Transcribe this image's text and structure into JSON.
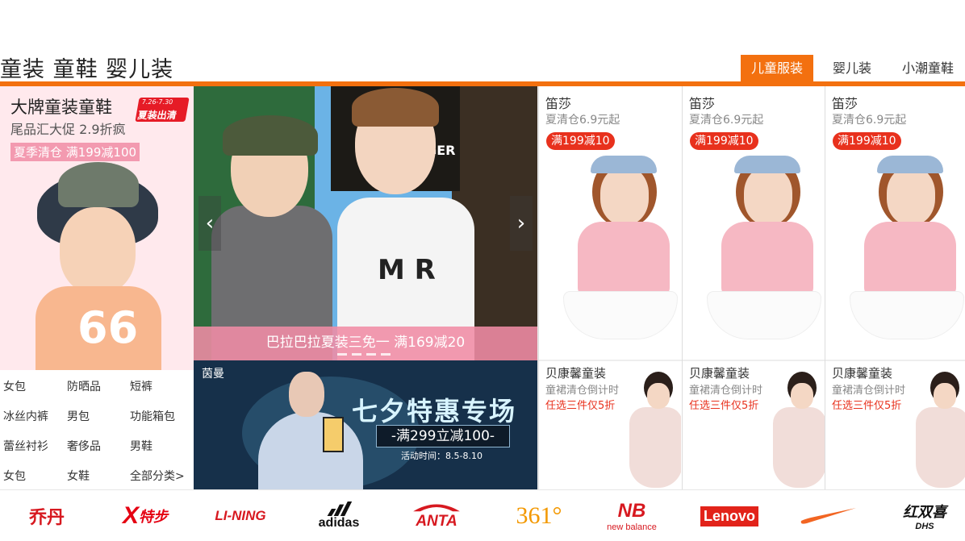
{
  "header": {
    "title": "童装 童鞋 婴儿装",
    "tabs": [
      {
        "label": "儿童服装",
        "active": true
      },
      {
        "label": "婴儿装",
        "active": false
      },
      {
        "label": "小潮童鞋",
        "active": false
      }
    ]
  },
  "left_promo": {
    "title": "大牌童装童鞋",
    "subtitle": "尾品汇大促 2.9折疯",
    "tag": "夏季清仓 满199减100",
    "stamp_date": "7.26-7.30",
    "stamp_text": "夏装出清",
    "shirt_number": "66"
  },
  "categories": [
    "女包",
    "防晒品",
    "短裤",
    "冰丝内裤",
    "男包",
    "功能箱包",
    "蕾丝衬衫",
    "奢侈品",
    "男鞋",
    "女包",
    "女鞋",
    "全部分类>"
  ],
  "carousel": {
    "caption": "巴拉巴拉夏装三免一  满169减20",
    "prev": "‹",
    "next": "›",
    "sign_text": "BEEF BURGER",
    "shirt_print": "M R"
  },
  "banner2": {
    "logo": "茵曼",
    "title": "七夕特惠专场",
    "offer": "-满299立减100-",
    "time": "活动时间：8.5-8.10"
  },
  "products_top": [
    {
      "brand": "笛莎",
      "desc": "夏清仓6.9元起",
      "badge": "满199减10"
    },
    {
      "brand": "笛莎",
      "desc": "夏清仓6.9元起",
      "badge": "满199减10"
    },
    {
      "brand": "笛莎",
      "desc": "夏清仓6.9元起",
      "badge": "满199减10"
    }
  ],
  "products_bottom": [
    {
      "brand": "贝康馨童装",
      "desc": "童裙清仓倒计时",
      "offer": "任选三件仅5折"
    },
    {
      "brand": "贝康馨童装",
      "desc": "童裙清仓倒计时",
      "offer": "任选三件仅5折"
    },
    {
      "brand": "贝康馨童装",
      "desc": "童裙清仓倒计时",
      "offer": "任选三件仅5折"
    }
  ],
  "brands": [
    {
      "name": "乔丹",
      "color": "#d71920"
    },
    {
      "name": "特步",
      "color": "#e50012"
    },
    {
      "name": "LI-NING",
      "color": "#d71920"
    },
    {
      "name": "adidas",
      "color": "#111111"
    },
    {
      "name": "ANTA",
      "color": "#d71920"
    },
    {
      "name": "361°",
      "color": "#f39800"
    },
    {
      "name": "new balance",
      "color": "#d71920"
    },
    {
      "name": "Lenovo",
      "color": "#e2231a"
    },
    {
      "name": "✓",
      "color": "#f26522"
    },
    {
      "name": "红双喜",
      "color": "#111111"
    }
  ],
  "brand_sub": {
    "dhs": "DHS"
  },
  "colors": {
    "accent": "#f3700f",
    "sale_red": "#e8311d",
    "promo_pink": "#ffe9ed"
  }
}
